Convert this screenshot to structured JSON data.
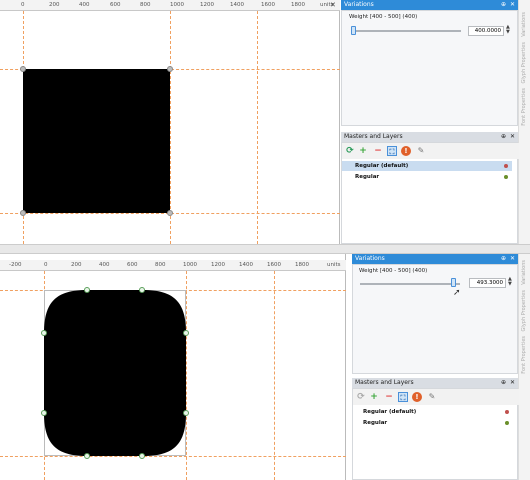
{
  "top": {
    "ruler": {
      "ticks": [
        "0",
        "200",
        "400",
        "600",
        "800",
        "1000",
        "1200",
        "1400",
        "1600",
        "1800"
      ],
      "units": "units"
    },
    "variations": {
      "title": "Variations",
      "axis_label": "Weight [400 - 500] (400)",
      "value": "400.0000",
      "slider_fraction": 0.0
    },
    "side_tabs": [
      "Variations",
      "Glyph Properties",
      "Font Properties"
    ],
    "masters": {
      "title": "Masters and Layers",
      "rows": [
        {
          "label": "Regular (default)",
          "color": "#c0504d",
          "selected": true
        },
        {
          "label": "Regular",
          "color": "#6a8f2a",
          "selected": false
        }
      ]
    }
  },
  "bottom": {
    "ruler": {
      "ticks": [
        "-200",
        "0",
        "200",
        "400",
        "600",
        "800",
        "1000",
        "1200",
        "1400",
        "1600",
        "1800"
      ],
      "units": "units"
    },
    "variations": {
      "title": "Variations",
      "axis_label": "Weight [400 - 500] (400)",
      "value": "493.3000",
      "slider_fraction": 0.933
    },
    "side_tabs": [
      "Variations",
      "Glyph Properties",
      "Font Properties"
    ],
    "masters": {
      "title": "Masters and Layers",
      "rows": [
        {
          "label": "Regular (default)",
          "color": "#c0504d",
          "selected": false
        },
        {
          "label": "Regular",
          "color": "#6a8f2a",
          "selected": false
        }
      ]
    }
  },
  "colors": {
    "panel_header": "#2e8bd8",
    "guide": "#f0a060",
    "node": "#5a9e5a",
    "selected_row": "#c9dcf0"
  },
  "icons": [
    "refresh-icon",
    "add-icon",
    "remove-icon",
    "fit-icon",
    "warning-icon",
    "wrench-icon"
  ]
}
